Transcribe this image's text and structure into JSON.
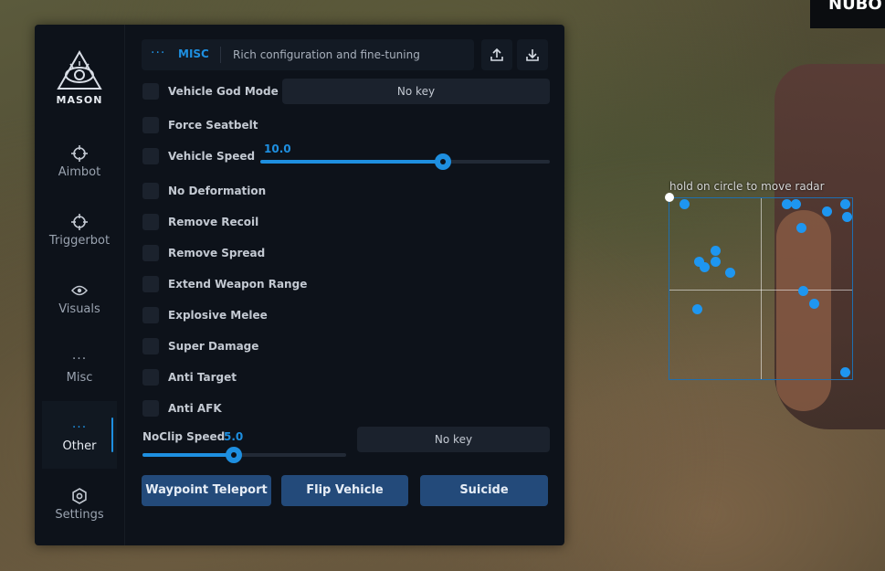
{
  "corner_label": "NUBO",
  "sidebar": {
    "brand": "MASON",
    "items": [
      {
        "label": "Aimbot",
        "icon": "crosshair-icon"
      },
      {
        "label": "Triggerbot",
        "icon": "crosshair-icon"
      },
      {
        "label": "Visuals",
        "icon": "eye-icon"
      },
      {
        "label": "Misc",
        "icon": "dots-icon"
      },
      {
        "label": "Other",
        "icon": "dots-icon",
        "active": true
      },
      {
        "label": "Settings",
        "icon": "gear-icon"
      }
    ]
  },
  "header": {
    "dots": "···",
    "title": "MISC",
    "subtitle": "Rich configuration and fine-tuning",
    "upload_icon": "upload-icon",
    "download_icon": "download-icon"
  },
  "options": [
    {
      "label": "Vehicle God Mode",
      "checked": false
    },
    {
      "label": "Force Seatbelt",
      "checked": false
    },
    {
      "label": "Vehicle Speed",
      "checked": false
    },
    {
      "label": "No Deformation",
      "checked": false
    },
    {
      "label": "Remove Recoil",
      "checked": false
    },
    {
      "label": "Remove Spread",
      "checked": false
    },
    {
      "label": "Extend Weapon Range",
      "checked": false
    },
    {
      "label": "Explosive Melee",
      "checked": false
    },
    {
      "label": "Super Damage",
      "checked": false
    },
    {
      "label": "Anti Target",
      "checked": false
    },
    {
      "label": "Anti AFK",
      "checked": false
    }
  ],
  "vehicle_godmode_key": "No key",
  "vehicle_speed": {
    "value_text": "10.0",
    "fraction": 0.63
  },
  "noclip": {
    "label": "NoClip Speed",
    "value_text": "5.0",
    "fraction": 0.45,
    "key": "No key"
  },
  "buttons": {
    "waypoint": "Waypoint Teleport",
    "flip": "Flip Vehicle",
    "suicide": "Suicide"
  },
  "radar": {
    "hint": "hold on circle to move radar",
    "blips": [
      [
        0.08,
        0.03
      ],
      [
        0.64,
        0.03
      ],
      [
        0.69,
        0.03
      ],
      [
        0.86,
        0.07
      ],
      [
        0.96,
        0.03
      ],
      [
        0.97,
        0.1
      ],
      [
        0.72,
        0.16
      ],
      [
        0.25,
        0.29
      ],
      [
        0.25,
        0.35
      ],
      [
        0.16,
        0.35
      ],
      [
        0.19,
        0.38
      ],
      [
        0.33,
        0.41
      ],
      [
        0.73,
        0.51
      ],
      [
        0.79,
        0.58
      ],
      [
        0.15,
        0.61
      ],
      [
        0.96,
        0.96
      ]
    ]
  }
}
